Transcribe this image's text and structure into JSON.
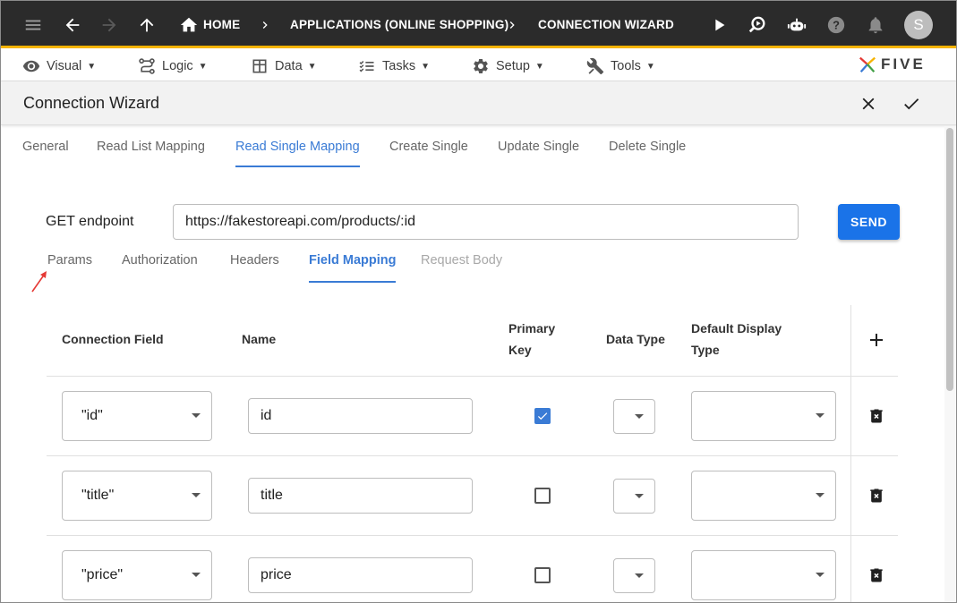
{
  "topbar": {
    "breadcrumbs": [
      "HOME",
      "APPLICATIONS (ONLINE SHOPPING)",
      "CONNECTION WIZARD"
    ],
    "avatar_initial": "S"
  },
  "menubar": {
    "items": [
      {
        "label": "Visual",
        "icon": "eye-icon"
      },
      {
        "label": "Logic",
        "icon": "logic-icon"
      },
      {
        "label": "Data",
        "icon": "table-icon"
      },
      {
        "label": "Tasks",
        "icon": "tasks-icon"
      },
      {
        "label": "Setup",
        "icon": "gear-icon"
      },
      {
        "label": "Tools",
        "icon": "tools-icon"
      }
    ],
    "logo_text": "FIVE"
  },
  "titlebar": {
    "title": "Connection Wizard"
  },
  "tabs": [
    {
      "label": "General",
      "active": false
    },
    {
      "label": "Read List Mapping",
      "active": false
    },
    {
      "label": "Read Single Mapping",
      "active": true
    },
    {
      "label": "Create Single",
      "active": false
    },
    {
      "label": "Update Single",
      "active": false
    },
    {
      "label": "Delete Single",
      "active": false
    }
  ],
  "endpoint": {
    "label": "GET endpoint",
    "value": "https://fakestoreapi.com/products/:id",
    "send_label": "SEND"
  },
  "subtabs": [
    {
      "label": "Params",
      "state": "normal"
    },
    {
      "label": "Authorization",
      "state": "normal"
    },
    {
      "label": "Headers",
      "state": "normal"
    },
    {
      "label": "Field Mapping",
      "state": "active"
    },
    {
      "label": "Request Body",
      "state": "disabled"
    }
  ],
  "table": {
    "headers": {
      "connection_field": "Connection Field",
      "name": "Name",
      "primary_key_1": "Primary",
      "primary_key_2": "Key",
      "data_type": "Data Type",
      "default_display_1": "Default Display",
      "default_display_2": "Type"
    },
    "rows": [
      {
        "connection_field": "\"id\"",
        "name": "id",
        "primary_key": true,
        "data_type": "",
        "display_type": ""
      },
      {
        "connection_field": "\"title\"",
        "name": "title",
        "primary_key": false,
        "data_type": "",
        "display_type": ""
      },
      {
        "connection_field": "\"price\"",
        "name": "price",
        "primary_key": false,
        "data_type": "",
        "display_type": ""
      }
    ]
  },
  "colors": {
    "accent": "#3a7bd5",
    "send_button": "#1a73e8",
    "topbar": "#2b2b2b",
    "topbar_border": "#f5b301",
    "annotation": "#e53935"
  }
}
